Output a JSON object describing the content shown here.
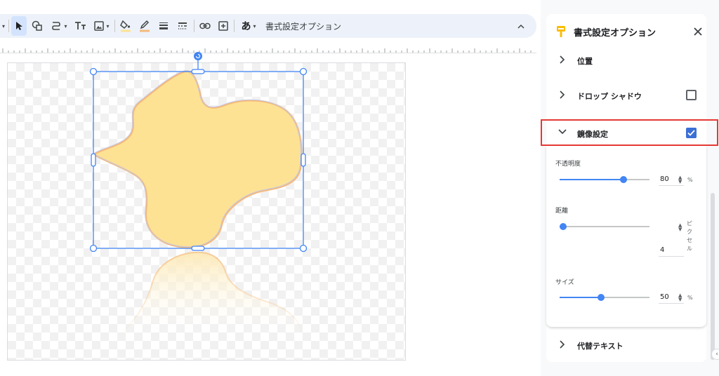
{
  "toolbar": {
    "tools": [
      {
        "icon": "select-arrow-icon",
        "active": true
      },
      {
        "icon": "shape-icon"
      },
      {
        "icon": "line-icon"
      },
      {
        "icon": "text-icon"
      },
      {
        "icon": "image-icon"
      },
      {
        "icon": "fill-color-icon"
      },
      {
        "icon": "border-color-icon"
      },
      {
        "icon": "border-weight-icon"
      },
      {
        "icon": "border-dash-icon"
      },
      {
        "icon": "link-icon"
      },
      {
        "icon": "comment-icon"
      },
      {
        "icon": "input-tools-icon"
      }
    ],
    "input_tools_label": "あ",
    "format_options_label": "書式設定オプション"
  },
  "panel": {
    "title": "書式設定オプション",
    "sections": {
      "position": {
        "label": "位置"
      },
      "drop_shadow": {
        "label": "ドロップ シャドウ",
        "checked": false
      },
      "reflection": {
        "label": "鏡像設定",
        "checked": true
      },
      "alt_text": {
        "label": "代替テキスト"
      }
    },
    "reflection": {
      "opacity": {
        "label": "不透明度",
        "value": "80",
        "unit": "%",
        "level": 0.8
      },
      "distance": {
        "label": "距離",
        "value": "4",
        "unit": "ピクセル",
        "level": 0.0
      },
      "size": {
        "label": "サイズ",
        "value": "50",
        "unit": "%",
        "level": 0.5
      }
    }
  },
  "colors": {
    "accent": "#4285f4",
    "shape_fill": "#fde293",
    "shape_stroke": "#f4b97c",
    "highlight": "#e53935",
    "toolbar_bg": "#edf2fa"
  }
}
